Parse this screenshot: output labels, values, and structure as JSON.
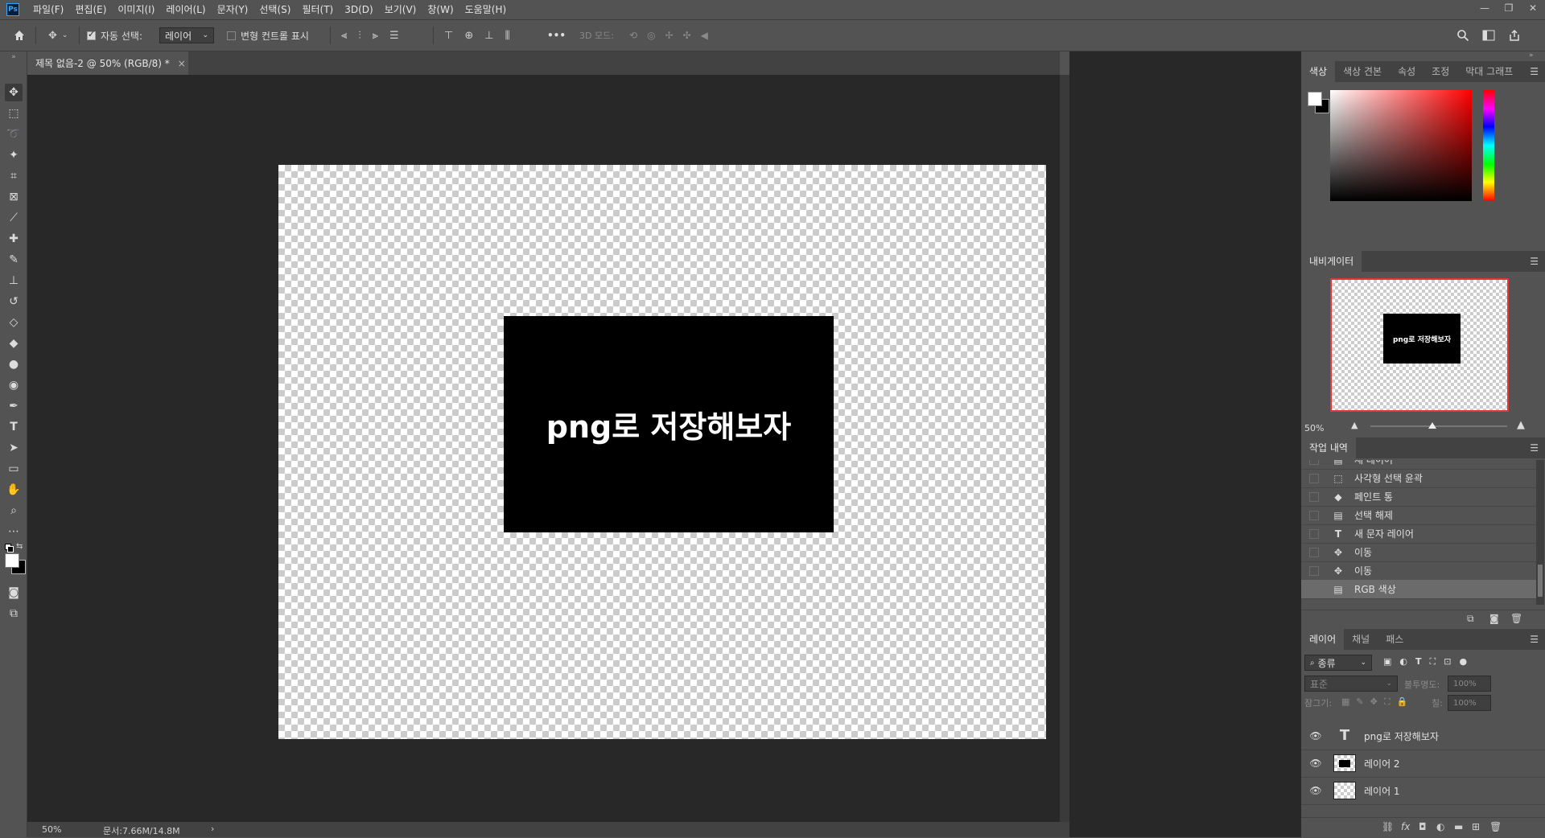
{
  "app": {
    "logo": "Ps"
  },
  "menu": [
    "파일(F)",
    "편집(E)",
    "이미지(I)",
    "레이어(L)",
    "문자(Y)",
    "선택(S)",
    "필터(T)",
    "3D(D)",
    "보기(V)",
    "창(W)",
    "도움말(H)"
  ],
  "window_controls": {
    "minimize": "—",
    "restore": "❐",
    "close": "✕"
  },
  "options": {
    "auto_select_label": "자동 선택:",
    "auto_select_value": "레이어",
    "transform_controls_label": "변형 컨트롤 표시",
    "more": "•••",
    "mode_3d_label": "3D 모드:"
  },
  "document": {
    "tab_title": "제목 없음-2 @ 50% (RGB/8) *",
    "close": "×",
    "canvas_text": "png로 저장해보자"
  },
  "status": {
    "zoom": "50%",
    "doc_size": "문서:7.66M/14.8M",
    "arrow": "›"
  },
  "color_panel": {
    "tabs": [
      "색상",
      "색상 견본",
      "속성",
      "조정",
      "막대 그래프"
    ],
    "foreground": "#ffffff",
    "background": "#000000"
  },
  "navigator": {
    "tab": "내비게이터",
    "zoom": "50%",
    "thumb_text": "png로 저장해보자"
  },
  "history": {
    "tab": "작업 내역",
    "items": [
      {
        "icon": "doc-icon",
        "label": "새 레이어"
      },
      {
        "icon": "marquee-icon",
        "label": "사각형 선택 윤곽"
      },
      {
        "icon": "bucket-icon",
        "label": "페인트 통"
      },
      {
        "icon": "doc-icon",
        "label": "선택 해제"
      },
      {
        "icon": "type-icon",
        "label": "새 문자 레이어"
      },
      {
        "icon": "move-icon",
        "label": "이동"
      },
      {
        "icon": "move-icon",
        "label": "이동"
      },
      {
        "icon": "doc-icon",
        "label": "RGB 색상"
      }
    ],
    "selected_index": 7
  },
  "layers_panel": {
    "tabs": [
      "레이어",
      "채널",
      "패스"
    ],
    "filter_kind": "종류",
    "blend_mode": "표준",
    "opacity_label": "불투명도:",
    "opacity_value": "100%",
    "lock_label": "잠그기:",
    "fill_label": "칠:",
    "fill_value": "100%",
    "layers": [
      {
        "type": "text",
        "name": "png로 저장해보자"
      },
      {
        "type": "raster",
        "name": "레이어 2"
      },
      {
        "type": "raster",
        "name": "레이어 1"
      }
    ]
  }
}
